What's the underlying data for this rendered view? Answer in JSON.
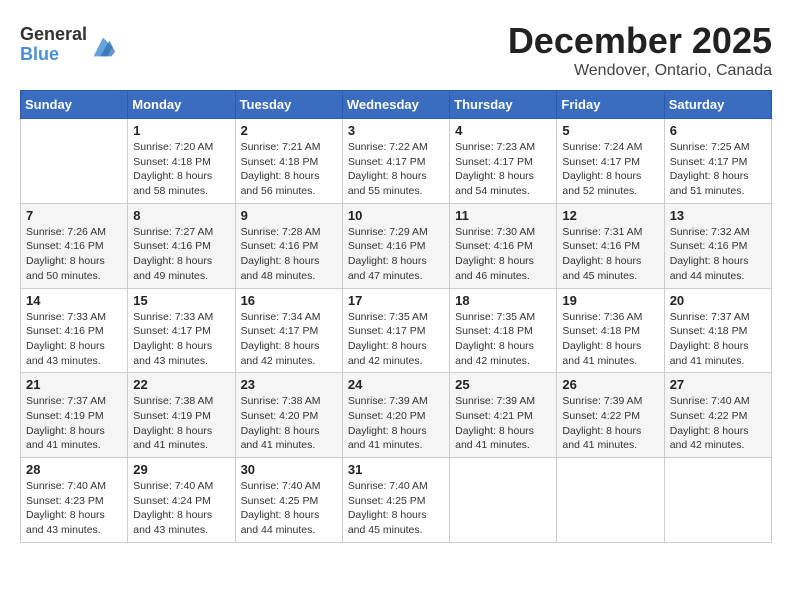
{
  "logo": {
    "general": "General",
    "blue": "Blue"
  },
  "header": {
    "month": "December 2025",
    "location": "Wendover, Ontario, Canada"
  },
  "weekdays": [
    "Sunday",
    "Monday",
    "Tuesday",
    "Wednesday",
    "Thursday",
    "Friday",
    "Saturday"
  ],
  "weeks": [
    [
      {
        "day": "",
        "info": ""
      },
      {
        "day": "1",
        "info": "Sunrise: 7:20 AM\nSunset: 4:18 PM\nDaylight: 8 hours\nand 58 minutes."
      },
      {
        "day": "2",
        "info": "Sunrise: 7:21 AM\nSunset: 4:18 PM\nDaylight: 8 hours\nand 56 minutes."
      },
      {
        "day": "3",
        "info": "Sunrise: 7:22 AM\nSunset: 4:17 PM\nDaylight: 8 hours\nand 55 minutes."
      },
      {
        "day": "4",
        "info": "Sunrise: 7:23 AM\nSunset: 4:17 PM\nDaylight: 8 hours\nand 54 minutes."
      },
      {
        "day": "5",
        "info": "Sunrise: 7:24 AM\nSunset: 4:17 PM\nDaylight: 8 hours\nand 52 minutes."
      },
      {
        "day": "6",
        "info": "Sunrise: 7:25 AM\nSunset: 4:17 PM\nDaylight: 8 hours\nand 51 minutes."
      }
    ],
    [
      {
        "day": "7",
        "info": "Sunrise: 7:26 AM\nSunset: 4:16 PM\nDaylight: 8 hours\nand 50 minutes."
      },
      {
        "day": "8",
        "info": "Sunrise: 7:27 AM\nSunset: 4:16 PM\nDaylight: 8 hours\nand 49 minutes."
      },
      {
        "day": "9",
        "info": "Sunrise: 7:28 AM\nSunset: 4:16 PM\nDaylight: 8 hours\nand 48 minutes."
      },
      {
        "day": "10",
        "info": "Sunrise: 7:29 AM\nSunset: 4:16 PM\nDaylight: 8 hours\nand 47 minutes."
      },
      {
        "day": "11",
        "info": "Sunrise: 7:30 AM\nSunset: 4:16 PM\nDaylight: 8 hours\nand 46 minutes."
      },
      {
        "day": "12",
        "info": "Sunrise: 7:31 AM\nSunset: 4:16 PM\nDaylight: 8 hours\nand 45 minutes."
      },
      {
        "day": "13",
        "info": "Sunrise: 7:32 AM\nSunset: 4:16 PM\nDaylight: 8 hours\nand 44 minutes."
      }
    ],
    [
      {
        "day": "14",
        "info": "Sunrise: 7:33 AM\nSunset: 4:16 PM\nDaylight: 8 hours\nand 43 minutes."
      },
      {
        "day": "15",
        "info": "Sunrise: 7:33 AM\nSunset: 4:17 PM\nDaylight: 8 hours\nand 43 minutes."
      },
      {
        "day": "16",
        "info": "Sunrise: 7:34 AM\nSunset: 4:17 PM\nDaylight: 8 hours\nand 42 minutes."
      },
      {
        "day": "17",
        "info": "Sunrise: 7:35 AM\nSunset: 4:17 PM\nDaylight: 8 hours\nand 42 minutes."
      },
      {
        "day": "18",
        "info": "Sunrise: 7:35 AM\nSunset: 4:18 PM\nDaylight: 8 hours\nand 42 minutes."
      },
      {
        "day": "19",
        "info": "Sunrise: 7:36 AM\nSunset: 4:18 PM\nDaylight: 8 hours\nand 41 minutes."
      },
      {
        "day": "20",
        "info": "Sunrise: 7:37 AM\nSunset: 4:18 PM\nDaylight: 8 hours\nand 41 minutes."
      }
    ],
    [
      {
        "day": "21",
        "info": "Sunrise: 7:37 AM\nSunset: 4:19 PM\nDaylight: 8 hours\nand 41 minutes."
      },
      {
        "day": "22",
        "info": "Sunrise: 7:38 AM\nSunset: 4:19 PM\nDaylight: 8 hours\nand 41 minutes."
      },
      {
        "day": "23",
        "info": "Sunrise: 7:38 AM\nSunset: 4:20 PM\nDaylight: 8 hours\nand 41 minutes."
      },
      {
        "day": "24",
        "info": "Sunrise: 7:39 AM\nSunset: 4:20 PM\nDaylight: 8 hours\nand 41 minutes."
      },
      {
        "day": "25",
        "info": "Sunrise: 7:39 AM\nSunset: 4:21 PM\nDaylight: 8 hours\nand 41 minutes."
      },
      {
        "day": "26",
        "info": "Sunrise: 7:39 AM\nSunset: 4:22 PM\nDaylight: 8 hours\nand 41 minutes."
      },
      {
        "day": "27",
        "info": "Sunrise: 7:40 AM\nSunset: 4:22 PM\nDaylight: 8 hours\nand 42 minutes."
      }
    ],
    [
      {
        "day": "28",
        "info": "Sunrise: 7:40 AM\nSunset: 4:23 PM\nDaylight: 8 hours\nand 43 minutes."
      },
      {
        "day": "29",
        "info": "Sunrise: 7:40 AM\nSunset: 4:24 PM\nDaylight: 8 hours\nand 43 minutes."
      },
      {
        "day": "30",
        "info": "Sunrise: 7:40 AM\nSunset: 4:25 PM\nDaylight: 8 hours\nand 44 minutes."
      },
      {
        "day": "31",
        "info": "Sunrise: 7:40 AM\nSunset: 4:25 PM\nDaylight: 8 hours\nand 45 minutes."
      },
      {
        "day": "",
        "info": ""
      },
      {
        "day": "",
        "info": ""
      },
      {
        "day": "",
        "info": ""
      }
    ]
  ]
}
